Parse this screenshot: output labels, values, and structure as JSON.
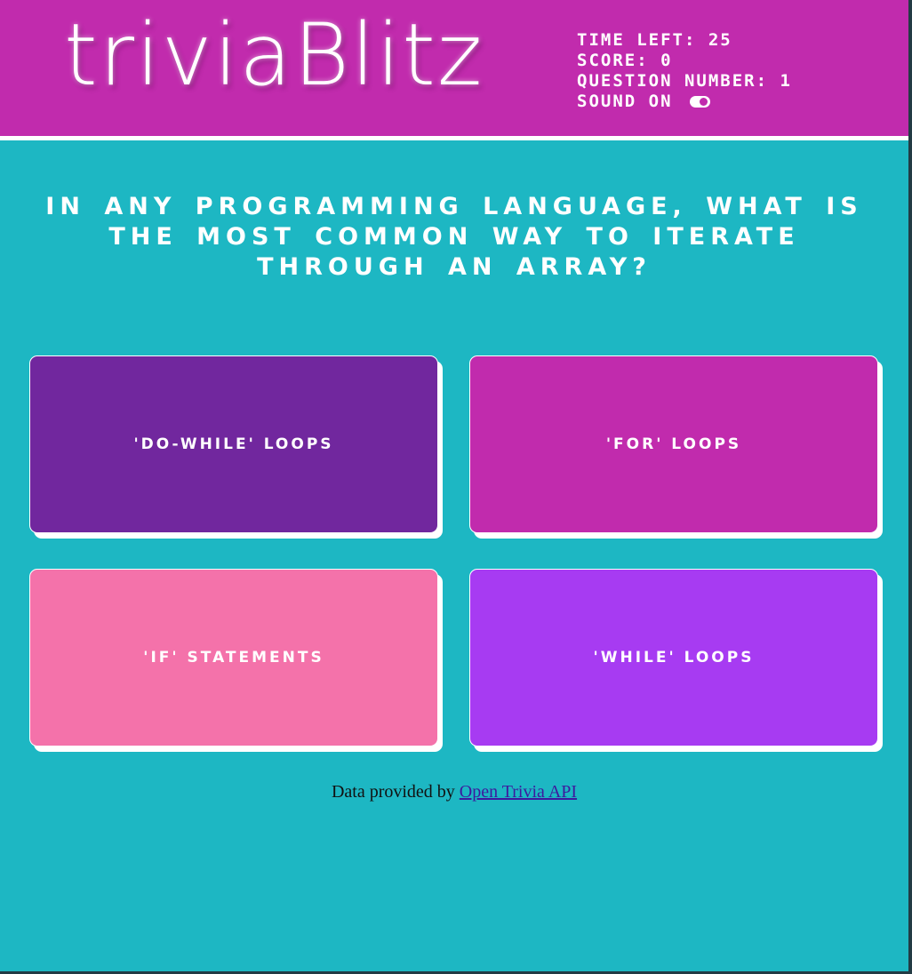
{
  "header": {
    "logo_text": "triviaBlitz",
    "stats": {
      "time_left_label": "TIME LEFT:",
      "time_left_value": "25",
      "score_label": "SCORE:",
      "score_value": "0",
      "question_number_label": "QUESTION NUMBER:",
      "question_number_value": "1",
      "sound_label": "SOUND ON"
    }
  },
  "question": {
    "text": "In any programming language, what is the most common way to iterate through an array?"
  },
  "answers": [
    {
      "label": "'Do-while' loops",
      "color": "#71279e"
    },
    {
      "label": "'For' loops",
      "color": "#c12bad"
    },
    {
      "label": "'If' Statements",
      "color": "#f472aa"
    },
    {
      "label": "'While' loops",
      "color": "#a73bf2"
    }
  ],
  "footer": {
    "prefix": "Data provided by",
    "link_text": "Open Trivia API"
  },
  "colors": {
    "header_bg": "#c12bad",
    "page_bg": "#1db7c3",
    "text": "#ffffff"
  }
}
